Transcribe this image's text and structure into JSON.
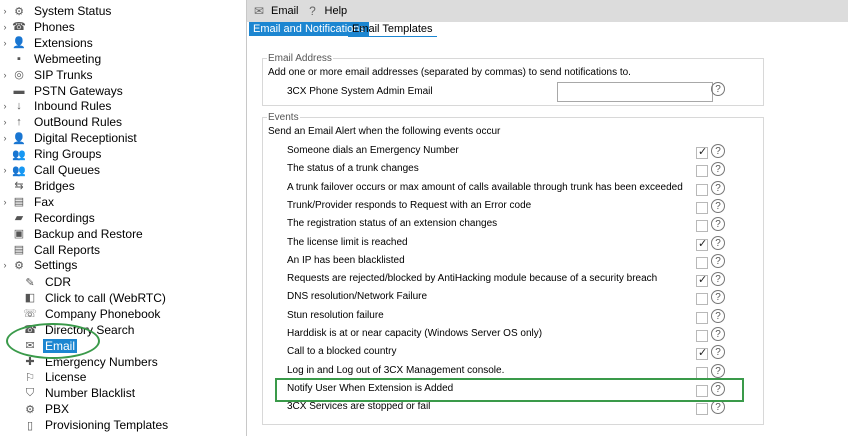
{
  "sidebar": {
    "items": [
      {
        "label": "System Status",
        "icon": "system-status-icon",
        "glyph": "⚙",
        "expand": true
      },
      {
        "label": "Phones",
        "icon": "phone-icon",
        "glyph": "☎",
        "expand": true
      },
      {
        "label": "Extensions",
        "icon": "extensions-icon",
        "glyph": "👤",
        "expand": true
      },
      {
        "label": "Webmeeting",
        "icon": "webmeeting-icon",
        "glyph": "▪",
        "expand": false
      },
      {
        "label": "SIP Trunks",
        "icon": "sip-trunk-icon",
        "glyph": "◎",
        "expand": true
      },
      {
        "label": "PSTN Gateways",
        "icon": "gateway-icon",
        "glyph": "▬",
        "expand": false
      },
      {
        "label": "Inbound Rules",
        "icon": "inbound-arrow-icon",
        "glyph": "↓",
        "expand": true
      },
      {
        "label": "OutBound Rules",
        "icon": "outbound-arrow-icon",
        "glyph": "↑",
        "expand": true
      },
      {
        "label": "Digital Receptionist",
        "icon": "receptionist-icon",
        "glyph": "👤",
        "expand": true
      },
      {
        "label": "Ring Groups",
        "icon": "ring-group-icon",
        "glyph": "👥",
        "expand": false
      },
      {
        "label": "Call Queues",
        "icon": "call-queue-icon",
        "glyph": "👥",
        "expand": true
      },
      {
        "label": "Bridges",
        "icon": "bridge-icon",
        "glyph": "⇆",
        "expand": false
      },
      {
        "label": "Fax",
        "icon": "fax-icon",
        "glyph": "▤",
        "expand": true
      },
      {
        "label": "Recordings",
        "icon": "recordings-folder-icon",
        "glyph": "▰",
        "expand": false
      },
      {
        "label": "Backup and Restore",
        "icon": "backup-icon",
        "glyph": "▣",
        "expand": false
      },
      {
        "label": "Call Reports",
        "icon": "call-reports-icon",
        "glyph": "▤",
        "expand": false
      },
      {
        "label": "Settings",
        "icon": "settings-icon",
        "glyph": "⚙",
        "expand": true
      }
    ],
    "settings_children": [
      {
        "label": "CDR",
        "icon": "cdr-icon",
        "glyph": "✎"
      },
      {
        "label": "Click to call (WebRTC)",
        "icon": "click-to-call-icon",
        "glyph": "◧"
      },
      {
        "label": "Company Phonebook",
        "icon": "phonebook-icon",
        "glyph": "☏"
      },
      {
        "label": "Directory Search",
        "icon": "directory-search-icon",
        "glyph": "☎"
      },
      {
        "label": "Email",
        "icon": "email-icon",
        "glyph": "✉",
        "selected": true
      },
      {
        "label": "Emergency Numbers",
        "icon": "emergency-icon",
        "glyph": "✚"
      },
      {
        "label": "License",
        "icon": "license-icon",
        "glyph": "⚐"
      },
      {
        "label": "Number Blacklist",
        "icon": "blacklist-icon",
        "glyph": "⛉"
      },
      {
        "label": "PBX",
        "icon": "pbx-icon",
        "glyph": "⚙"
      },
      {
        "label": "Provisioning Templates",
        "icon": "provisioning-icon",
        "glyph": "▯"
      }
    ]
  },
  "toolbar": {
    "email_label": "Email",
    "help_label": "Help"
  },
  "tabs": {
    "notifications": "Email and Notifications",
    "templates": "Email Templates"
  },
  "email_address": {
    "legend": "Email Address",
    "description": "Add one or more email addresses (separated by commas) to send notifications to.",
    "field_label": "3CX Phone System Admin Email",
    "value": ""
  },
  "events": {
    "legend": "Events",
    "description": "Send an Email Alert when the following events occur",
    "rows": [
      {
        "label": "Someone dials an Emergency Number",
        "checked": true
      },
      {
        "label": "The status of a trunk changes",
        "checked": false
      },
      {
        "label": "A trunk failover occurs or max amount of calls available through trunk has been exceeded",
        "checked": false
      },
      {
        "label": "Trunk/Provider responds to Request with an Error code",
        "checked": false
      },
      {
        "label": "The registration status of an extension changes",
        "checked": false
      },
      {
        "label": "The license limit is reached",
        "checked": true
      },
      {
        "label": "An IP has been blacklisted",
        "checked": false
      },
      {
        "label": "Requests are rejected/blocked by AntiHacking module because of a security breach",
        "checked": true
      },
      {
        "label": "DNS resolution/Network Failure",
        "checked": false
      },
      {
        "label": "Stun resolution failure",
        "checked": false
      },
      {
        "label": "Harddisk is at or near capacity (Windows Server OS only)",
        "checked": false
      },
      {
        "label": "Call to a blocked country",
        "checked": true
      },
      {
        "label": "Log in and Log out of 3CX Management console.",
        "checked": false
      },
      {
        "label": "Notify User When Extension is Added",
        "checked": false
      },
      {
        "label": "3CX Services are stopped or fail",
        "checked": false
      }
    ]
  },
  "colors": {
    "accent": "#1c86d1",
    "annotation": "#3a9a4a"
  }
}
